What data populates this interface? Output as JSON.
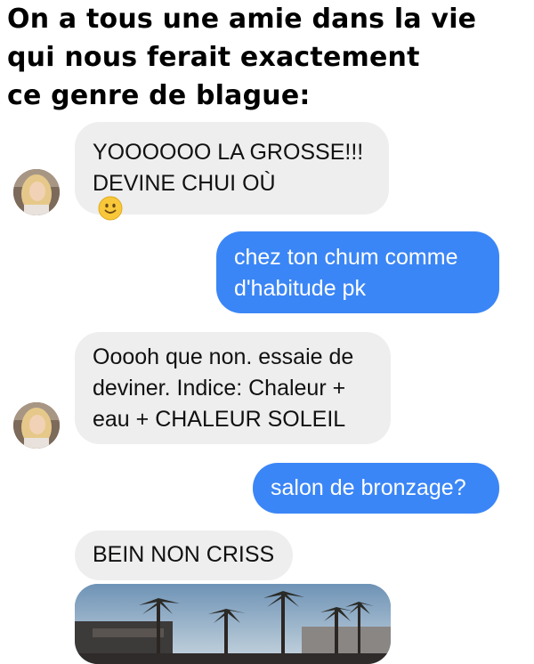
{
  "caption": {
    "line1": "On a tous une amie dans la vie",
    "line2": "qui nous ferait exactement",
    "line3": "ce genre de blague:"
  },
  "messages": [
    {
      "direction": "incoming",
      "lines": [
        "YOOOOOO LA GROSSE!!!",
        "DEVINE CHUI OÙ"
      ],
      "emoji": "slightly-smiling-face-icon"
    },
    {
      "direction": "outgoing",
      "lines": [
        "chez ton chum comme",
        "d'habitude pk"
      ]
    },
    {
      "direction": "incoming",
      "lines": [
        "Ooooh que non. essaie de",
        "deviner. Indice: Chaleur +",
        "eau + CHALEUR SOLEIL"
      ]
    },
    {
      "direction": "outgoing",
      "lines": [
        "salon de bronzage?"
      ]
    },
    {
      "direction": "incoming",
      "lines": [
        "BEIN NON CRISS"
      ]
    },
    {
      "direction": "incoming",
      "type": "photo",
      "content": "palm trees photo"
    }
  ],
  "colors": {
    "incoming_bubble": "#eeeeef",
    "outgoing_bubble": "#3b86f6",
    "outgoing_text": "#ffffff",
    "incoming_text": "#111111"
  },
  "icons": {
    "avatar": "contact-avatar",
    "emoji": "slightly-smiling-face-icon"
  }
}
